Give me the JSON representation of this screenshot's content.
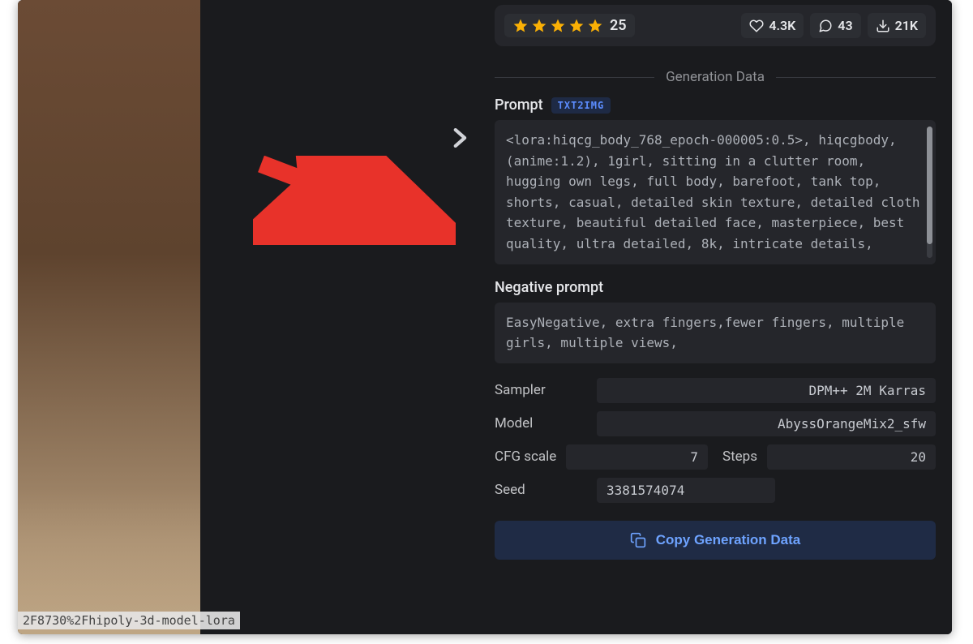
{
  "url_overlay": "2F8730%2Fhipoly-3d-model-lora",
  "stats": {
    "rating_count": "25",
    "likes": "4.3K",
    "comments": "43",
    "downloads": "21K"
  },
  "generation": {
    "divider_label": "Generation Data",
    "prompt_label": "Prompt",
    "prompt_tag": "TXT2IMG",
    "prompt_text": "<lora:hiqcg_body_768_epoch-000005:0.5>, hiqcgbody, (anime:1.2), 1girl, sitting in a clutter room, hugging own legs, full body, barefoot, tank top, shorts, casual, detailed skin texture, detailed cloth texture, beautiful detailed face, masterpiece, best quality, ultra detailed, 8k, intricate details,",
    "negative_label": "Negative prompt",
    "negative_text": "EasyNegative, extra fingers,fewer fingers, multiple girls, multiple views,",
    "params": {
      "sampler_label": "Sampler",
      "sampler_value": "DPM++ 2M Karras",
      "model_label": "Model",
      "model_value": "AbyssOrangeMix2_sfw",
      "cfg_label": "CFG scale",
      "cfg_value": "7",
      "steps_label": "Steps",
      "steps_value": "20",
      "seed_label": "Seed",
      "seed_value": "3381574074"
    },
    "copy_button": "Copy Generation Data"
  }
}
